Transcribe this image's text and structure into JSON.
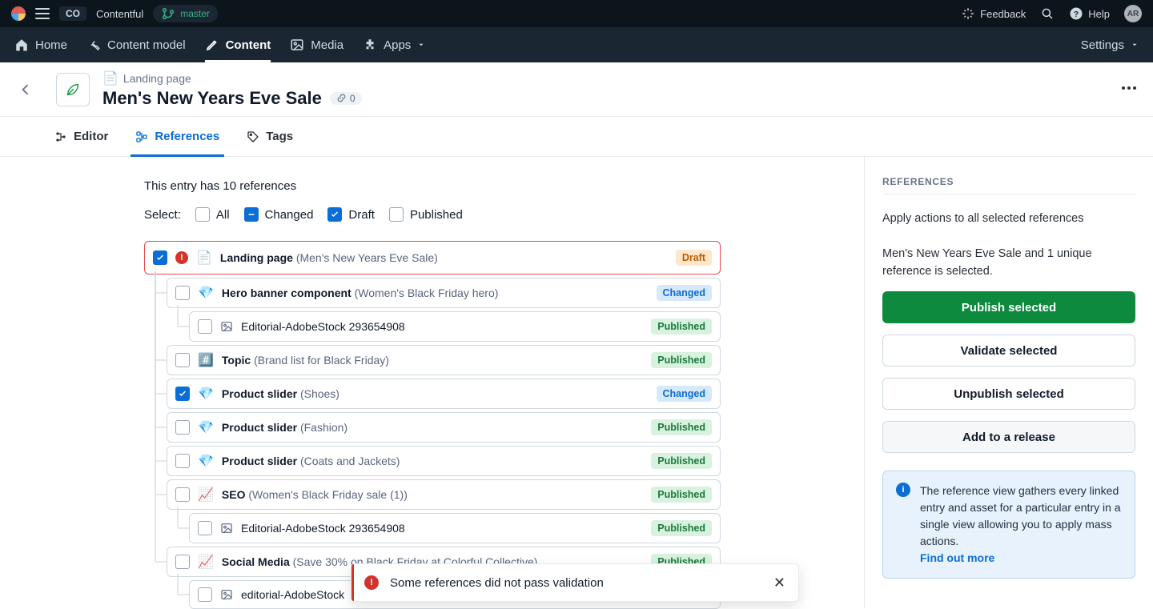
{
  "topbar": {
    "org_badge": "CO",
    "app_name": "Contentful",
    "branch": "master",
    "feedback": "Feedback",
    "help": "Help",
    "avatar_initials": "AR"
  },
  "nav": {
    "home": "Home",
    "content_model": "Content model",
    "content": "Content",
    "media": "Media",
    "apps": "Apps",
    "settings": "Settings"
  },
  "header": {
    "content_type_label": "Landing page",
    "title": "Men's New Years Eve Sale",
    "incoming_links_count": "0"
  },
  "tabs": {
    "editor": "Editor",
    "references": "References",
    "tags": "Tags"
  },
  "summary_line": "This entry has 10 references",
  "select": {
    "label": "Select:",
    "all": "All",
    "changed": "Changed",
    "draft": "Draft",
    "published": "Published"
  },
  "rows": [
    {
      "indent": 0,
      "checked": true,
      "error": true,
      "icon": "📄",
      "type": "Landing page",
      "paren": "Men's New Years Eve Sale",
      "status": "Draft",
      "root": true
    },
    {
      "indent": 1,
      "checked": false,
      "error": false,
      "icon": "💎",
      "type": "Hero banner component",
      "paren": "Women's Black Friday hero",
      "status": "Changed",
      "root": false
    },
    {
      "indent": 2,
      "checked": false,
      "error": false,
      "icon": "asset",
      "type": "",
      "paren": "Editorial-AdobeStock 293654908",
      "status": "Published",
      "root": false
    },
    {
      "indent": 1,
      "checked": false,
      "error": false,
      "icon": "#️⃣",
      "type": "Topic",
      "paren": "Brand list for Black Friday",
      "status": "Published",
      "root": false
    },
    {
      "indent": 1,
      "checked": true,
      "error": false,
      "icon": "💎",
      "type": "Product slider",
      "paren": "Shoes",
      "status": "Changed",
      "root": false
    },
    {
      "indent": 1,
      "checked": false,
      "error": false,
      "icon": "💎",
      "type": "Product slider",
      "paren": "Fashion",
      "status": "Published",
      "root": false
    },
    {
      "indent": 1,
      "checked": false,
      "error": false,
      "icon": "💎",
      "type": "Product slider",
      "paren": "Coats and Jackets",
      "status": "Published",
      "root": false
    },
    {
      "indent": 1,
      "checked": false,
      "error": false,
      "icon": "📈",
      "type": "SEO",
      "paren": "Women's Black Friday sale (1)",
      "status": "Published",
      "root": false
    },
    {
      "indent": 2,
      "checked": false,
      "error": false,
      "icon": "asset",
      "type": "",
      "paren": "Editorial-AdobeStock 293654908",
      "status": "Published",
      "root": false
    },
    {
      "indent": 1,
      "checked": false,
      "error": false,
      "icon": "📈",
      "type": "Social Media",
      "paren": "Save 30% on Black Friday at Colorful Collective",
      "status": "Published",
      "root": false
    },
    {
      "indent": 2,
      "checked": false,
      "error": false,
      "icon": "asset",
      "type": "",
      "paren": "editorial-AdobeStock",
      "status": "",
      "root": false
    }
  ],
  "sidebar": {
    "heading": "REFERENCES",
    "note1": "Apply actions to all selected references",
    "note2": "Men's New Years Eve Sale and 1 unique reference is selected.",
    "publish": "Publish selected",
    "validate": "Validate selected",
    "unpublish": "Unpublish selected",
    "release": "Add to a release",
    "info_text": "The reference view gathers every linked entry and asset for a particular entry in a single view allowing you to apply mass actions.",
    "info_link": "Find out more"
  },
  "toast": {
    "message": "Some references did not pass validation"
  }
}
